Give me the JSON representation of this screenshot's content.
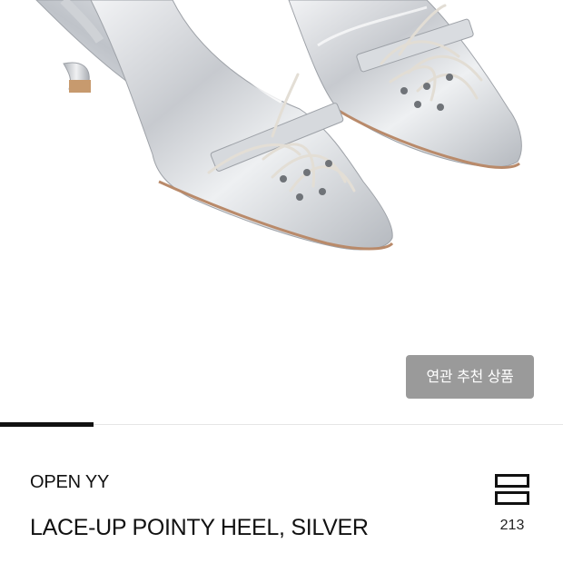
{
  "product": {
    "image_alt": "silver lace-up pointy slingback heels",
    "related_button_label": "연관 추천 상품",
    "gallery_progress": 0.166,
    "brand": "OPEN YY",
    "title": "LACE-UP POINTY HEEL, SILVER",
    "wishlist_count": "213",
    "wishlist_icon": "bookmark-stack-icon"
  },
  "colors": {
    "button_bg": "#9a9a9a",
    "progress_fill": "#111111",
    "text": "#111111",
    "shoe_silver": "#d4d7dc"
  }
}
